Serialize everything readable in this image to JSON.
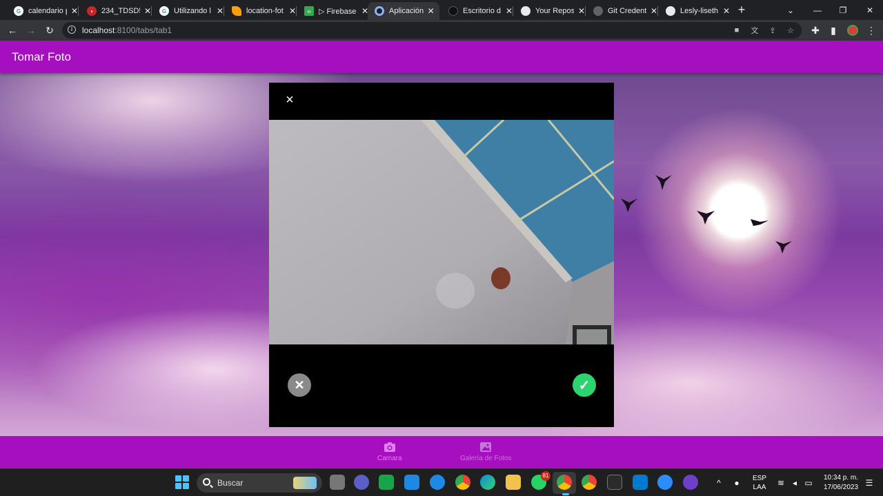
{
  "browser": {
    "tabs": [
      {
        "label": "calendario p",
        "favicon": "google-icon",
        "color": "#4285f4"
      },
      {
        "label": "234_TDSD5",
        "favicon": "scribd-icon",
        "color": "#c62828"
      },
      {
        "label": "Utilizando l",
        "favicon": "google-icon",
        "color": "#4285f4"
      },
      {
        "label": "location-fot",
        "favicon": "firebase-icon",
        "color": "#ffa000"
      },
      {
        "label": "▷ Firebase",
        "favicon": "code-icon",
        "color": "#34a853"
      },
      {
        "label": "Aplicación I",
        "favicon": "globe-icon",
        "color": "#4285f4"
      },
      {
        "label": "Escritorio d",
        "favicon": "github-icon",
        "color": "#333333"
      },
      {
        "label": "Your Reposi",
        "favicon": "github-icon",
        "color": "#e8eaed"
      },
      {
        "label": "Git Credent",
        "favicon": "globe-icon",
        "color": "#9aa0a6"
      },
      {
        "label": "Lesly-liseth",
        "favicon": "github-icon",
        "color": "#e8eaed"
      }
    ],
    "new_tab": "+",
    "url_host": "localhost",
    "url_path": ":8100/tabs/tab1"
  },
  "app": {
    "title": "Tomar Foto",
    "camera": {
      "close_label": "×",
      "cancel_label": "✕",
      "confirm_label": "✓"
    },
    "tabbar": [
      {
        "label": "Camara"
      },
      {
        "label": "Galería de Fotos"
      }
    ],
    "colors": {
      "primary": "#a50fc0",
      "confirm": "#2dd36f"
    }
  },
  "taskbar": {
    "search_placeholder": "Buscar",
    "whatsapp_badge": "81",
    "lang_top": "ESP",
    "lang_bottom": "LAA",
    "time": "10:34 p. m.",
    "date": "17/06/2023"
  }
}
